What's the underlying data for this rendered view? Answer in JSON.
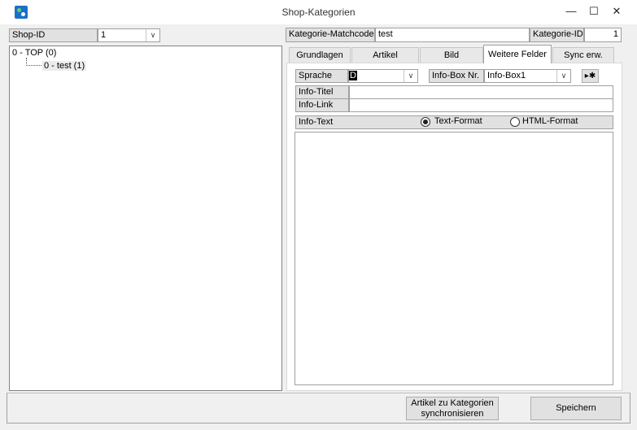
{
  "window": {
    "title": "Shop-Kategorien",
    "minimize_glyph": "—",
    "maximize_glyph": "☐",
    "close_glyph": "✕"
  },
  "left": {
    "shop_id_label": "Shop-ID",
    "shop_id_value": "1",
    "tree": [
      {
        "label": "0 - TOP (0)"
      },
      {
        "label": "0 - test (1)"
      }
    ]
  },
  "header": {
    "matchcode_label": "Kategorie-Matchcode",
    "matchcode_value": "test",
    "kategorie_id_label": "Kategorie-ID",
    "kategorie_id_value": "1"
  },
  "tabs": [
    {
      "label": "Grundlagen"
    },
    {
      "label": "Artikel"
    },
    {
      "label": "Bild"
    },
    {
      "label": "Weitere Felder",
      "active": true
    },
    {
      "label": "Sync erw."
    }
  ],
  "form": {
    "sprache_label": "Sprache",
    "sprache_value": "D",
    "infobox_label": "Info-Box Nr.",
    "infobox_value": "Info-Box1",
    "special_button": "▸✱",
    "info_titel_label": "Info-Titel",
    "info_titel_value": "",
    "info_link_label": "Info-Link",
    "info_link_value": "",
    "info_text_label": "Info-Text",
    "radio_text": "Text-Format",
    "radio_html": "HTML-Format",
    "radio_selected": "text",
    "info_text_value": ""
  },
  "footer": {
    "sync_button_line1": "Artikel zu Kategorien",
    "sync_button_line2": "synchronisieren",
    "save_button": "Speichern"
  },
  "icons": {
    "dropdown": "chevron-down-icon",
    "app": "app-icon"
  }
}
